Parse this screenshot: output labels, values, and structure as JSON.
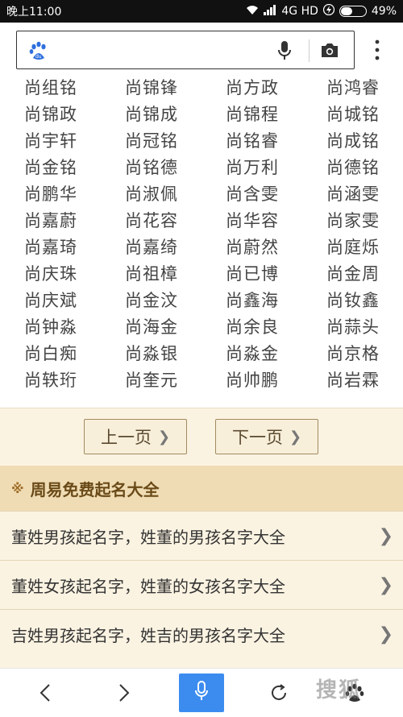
{
  "status_bar": {
    "time": "晚上11:00",
    "network": "4G HD",
    "battery": "49%"
  },
  "search": {
    "value": "",
    "placeholder": ""
  },
  "names_grid": [
    [
      "尚组铭",
      "尚锦锋",
      "尚方政",
      "尚鸿睿"
    ],
    [
      "尚锦政",
      "尚锦成",
      "尚锦程",
      "尚城铭"
    ],
    [
      "尚宇轩",
      "尚冠铭",
      "尚铭睿",
      "尚成铭"
    ],
    [
      "尚金铭",
      "尚铭德",
      "尚万利",
      "尚德铭"
    ],
    [
      "尚鹏华",
      "尚淑佩",
      "尚含雯",
      "尚涵雯"
    ],
    [
      "尚嘉蔚",
      "尚花容",
      "尚华容",
      "尚家雯"
    ],
    [
      "尚嘉琦",
      "尚嘉绮",
      "尚蔚然",
      "尚庭烁"
    ],
    [
      "尚庆珠",
      "尚祖樟",
      "尚已博",
      "尚金周"
    ],
    [
      "尚庆斌",
      "尚金汶",
      "尚鑫海",
      "尚钕鑫"
    ],
    [
      "尚钟淼",
      "尚海金",
      "尚余良",
      "尚蒜头"
    ],
    [
      "尚白痴",
      "尚淼银",
      "尚淼金",
      "尚京格"
    ],
    [
      "尚轶珩",
      "尚奎元",
      "尚帅鹏",
      "尚岩霖"
    ]
  ],
  "pager": {
    "prev_label": "上一页",
    "next_label": "下一页"
  },
  "section": {
    "title": "周易免费起名大全"
  },
  "links": [
    "董姓男孩起名字，姓董的男孩名字大全",
    "董姓女孩起名字，姓董的女孩名字大全",
    "吉姓男孩起名字，姓吉的男孩名字大全"
  ],
  "watermark": "搜狐",
  "colors": {
    "accent_blue": "#3c8cf0",
    "section_bg": "#efdcb4",
    "row_bg": "#fbf3e2"
  },
  "icons": {
    "status": [
      "wifi-icon",
      "signal-icon",
      "charging-icon",
      "battery-icon"
    ],
    "search": [
      "baidu-paw-logo",
      "microphone-icon",
      "camera-icon",
      "more-vertical-icon"
    ],
    "nav": [
      "back-icon",
      "forward-icon",
      "voice-icon",
      "refresh-icon",
      "baidu-paw-icon"
    ]
  }
}
